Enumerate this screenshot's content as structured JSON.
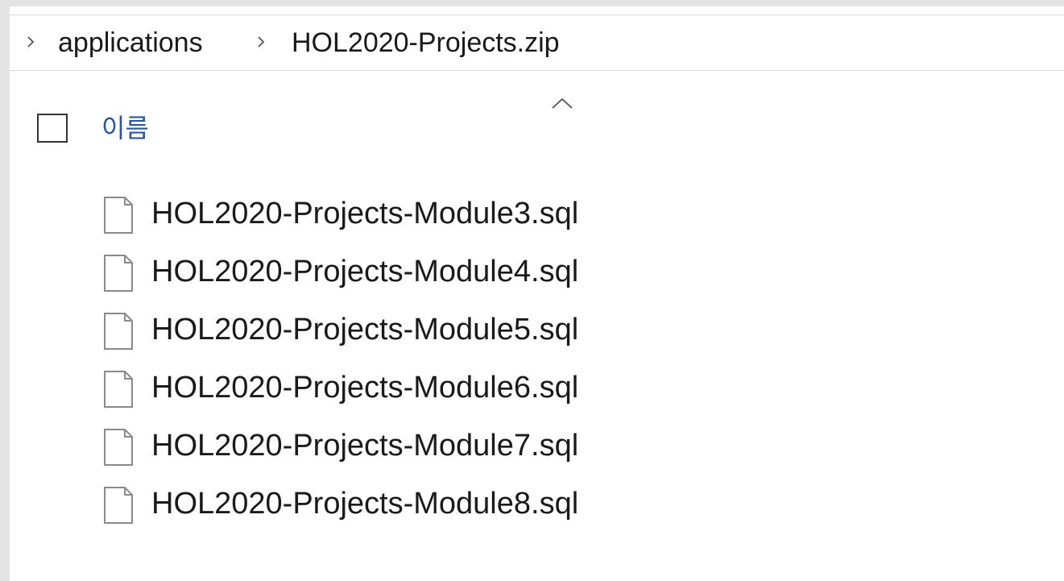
{
  "breadcrumb": {
    "items": [
      {
        "label": "applications"
      },
      {
        "label": "HOL2020-Projects.zip"
      }
    ]
  },
  "header": {
    "name_column_label": "이름",
    "sort_direction": "ascending"
  },
  "files": [
    {
      "name": "HOL2020-Projects-Module3.sql",
      "icon": "file-icon"
    },
    {
      "name": "HOL2020-Projects-Module4.sql",
      "icon": "file-icon"
    },
    {
      "name": "HOL2020-Projects-Module5.sql",
      "icon": "file-icon"
    },
    {
      "name": "HOL2020-Projects-Module6.sql",
      "icon": "file-icon"
    },
    {
      "name": "HOL2020-Projects-Module7.sql",
      "icon": "file-icon"
    },
    {
      "name": "HOL2020-Projects-Module8.sql",
      "icon": "file-icon"
    }
  ],
  "colors": {
    "header_text": "#2b5797",
    "text": "#1a1a1a",
    "background": "#ffffff",
    "frame": "#e3e3e3"
  }
}
